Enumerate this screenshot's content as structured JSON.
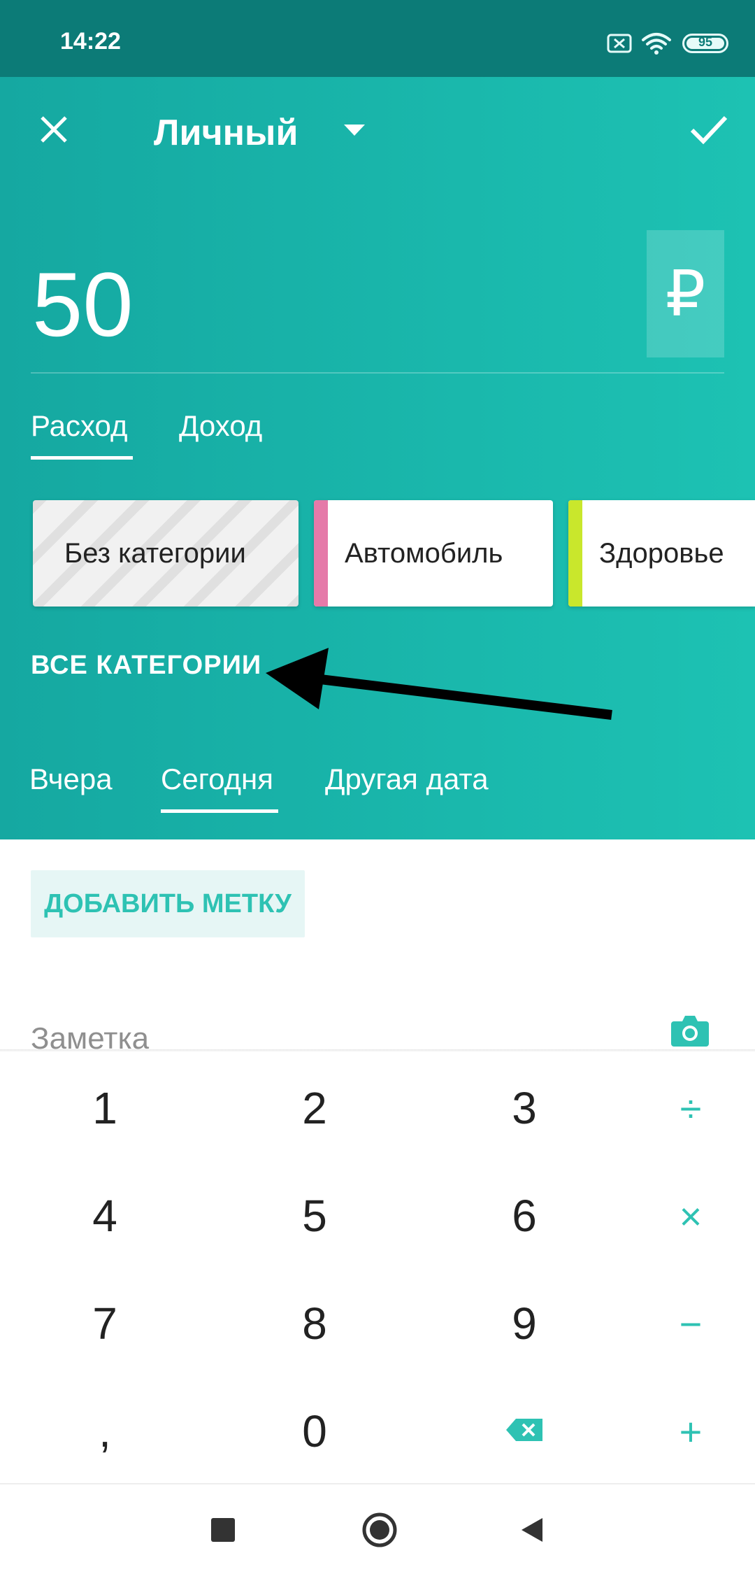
{
  "status_bar": {
    "time": "14:22",
    "battery": "95"
  },
  "header": {
    "account_title": "Личный"
  },
  "amount": {
    "value": "50",
    "currency_symbol": "₽"
  },
  "type_tabs": [
    {
      "label": "Расход",
      "active": true
    },
    {
      "label": "Доход",
      "active": false
    }
  ],
  "categories": [
    {
      "label": "Без категории",
      "color": null
    },
    {
      "label": "Автомобиль",
      "color": "#e57aa9"
    },
    {
      "label": "Здоровье",
      "color": "#c9e72c"
    }
  ],
  "all_categories_label": "ВСЕ КАТЕГОРИИ",
  "date_tabs": [
    {
      "label": "Вчера",
      "active": false
    },
    {
      "label": "Сегодня",
      "active": true
    },
    {
      "label": "Другая дата",
      "active": false
    }
  ],
  "add_tag_label": "ДОБАВИТЬ МЕТКУ",
  "note_placeholder": "Заметка",
  "keypad": {
    "digits": [
      "1",
      "2",
      "3",
      "4",
      "5",
      "6",
      "7",
      "8",
      "9",
      ",",
      "0"
    ],
    "ops": [
      "÷",
      "×",
      "−",
      "+"
    ]
  },
  "colors": {
    "accent": "#2ec2b3",
    "hero_start": "#15a8a1",
    "hero_end": "#1dc2b3",
    "status_bar": "#0c7b77"
  }
}
